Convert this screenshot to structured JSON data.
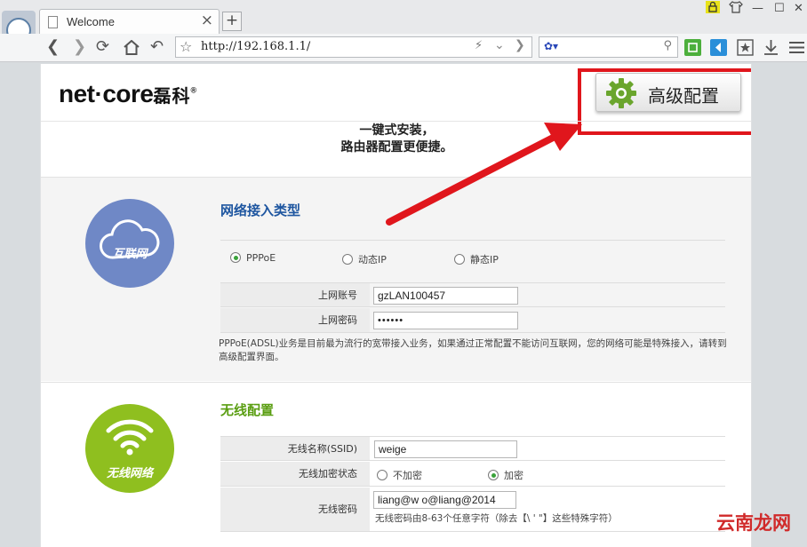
{
  "browser": {
    "tab_title": "Welcome",
    "tab_close": "×",
    "new_tab": "+",
    "url": "http://192.168.1.1/",
    "win_minimize": "—",
    "win_maximize": "☐",
    "win_close": "✕"
  },
  "header": {
    "brand_latin": "net·core",
    "brand_cn": "磊科",
    "brand_mark": "®",
    "advanced_button": "高级配置",
    "tagline_line1": "一键式安装，",
    "tagline_line2": "路由器配置更便捷。"
  },
  "wan": {
    "icon_label": "互联网",
    "title": "网络接入类型",
    "options": [
      {
        "label": "PPPoE",
        "selected": true
      },
      {
        "label": "动态IP",
        "selected": false
      },
      {
        "label": "静态IP",
        "selected": false
      }
    ],
    "account_label": "上网账号",
    "account_value": "gzLAN100457",
    "password_label": "上网密码",
    "password_value": "••••••",
    "note": "PPPoE(ADSL)业务是目前最为流行的宽带接入业务，如果通过正常配置不能访问互联网，您的网络可能是特殊接入，请转到高级配置界面。"
  },
  "wireless": {
    "icon_label": "无线网络",
    "title": "无线配置",
    "ssid_label": "无线名称(SSID)",
    "ssid_value": "weige",
    "encrypt_label": "无线加密状态",
    "encrypt_options": [
      {
        "label": "不加密",
        "selected": false
      },
      {
        "label": "加密",
        "selected": true
      }
    ],
    "password_label": "无线密码",
    "password_value": "liang@w  o@liang@2014",
    "password_hint": "无线密码由8-63个任意字符（除去【\\ ' \"】这些特殊字符）"
  },
  "watermark": "云南龙网",
  "colors": {
    "wan_title": "#1e56a0",
    "wireless_title": "#5a9e12",
    "wan_circle": "#6f88c6",
    "wireless_circle": "#8fbf1f",
    "highlight": "#e0161c"
  }
}
